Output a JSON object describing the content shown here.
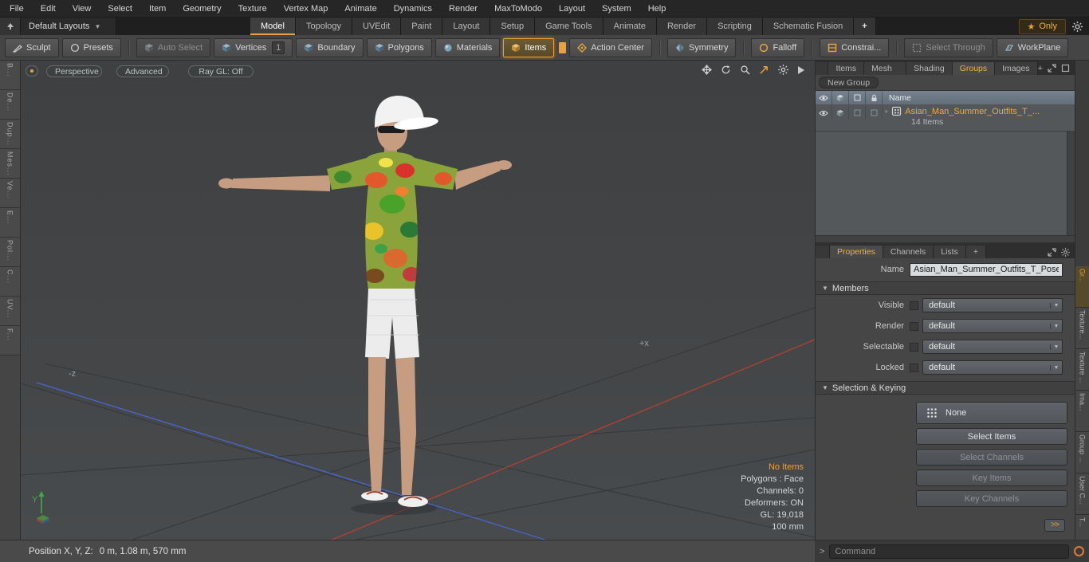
{
  "menu": {
    "items": [
      "File",
      "Edit",
      "View",
      "Select",
      "Item",
      "Geometry",
      "Texture",
      "Vertex Map",
      "Animate",
      "Dynamics",
      "Render",
      "MaxToModo",
      "Layout",
      "System",
      "Help"
    ]
  },
  "layout_bar": {
    "layout_selector": "Default Layouts",
    "tabs": [
      "Model",
      "Topology",
      "UVEdit",
      "Paint",
      "Layout",
      "Setup",
      "Game Tools",
      "Animate",
      "Render",
      "Scripting",
      "Schematic Fusion"
    ],
    "active_tab": "Model",
    "plus_tab": "+",
    "star": "★",
    "only_label": "Only"
  },
  "toolbar": {
    "sculpt": "Sculpt",
    "presets": "Presets",
    "auto_select": "Auto Select",
    "vertices": "Vertices",
    "vertices_count": "1",
    "boundary": "Boundary",
    "polygons": "Polygons",
    "materials": "Materials",
    "items": "Items",
    "action_center": "Action Center",
    "symmetry": "Symmetry",
    "falloff": "Falloff",
    "constraints": "Constrai...",
    "select_through": "Select Through",
    "workplane": "WorkPlane"
  },
  "left_strip": {
    "tabs": [
      "B...",
      "De...",
      "Dup...",
      "Mes...",
      "Ve...",
      "E...",
      "Pol...",
      "C...",
      "UV...",
      "F..."
    ]
  },
  "viewport": {
    "view_mode": "Perspective",
    "shading_mode": "Advanced",
    "raygl": "Ray GL: Off",
    "axis_labels": {
      "neg_z": "-z",
      "pos_x": "+x",
      "y": "Y"
    },
    "info": {
      "selection": "No Items",
      "lines": [
        "Polygons : Face",
        "Channels: 0",
        "Deformers: ON",
        "GL: 19,018",
        "100 mm"
      ]
    }
  },
  "right_panel": {
    "tabs": [
      "Items",
      "Mesh ...",
      "Shading",
      "Groups",
      "Images"
    ],
    "active_tab": "Groups",
    "plus": "+",
    "new_group": "New Group",
    "list": {
      "name_header": "Name",
      "rows": [
        {
          "expander": "+",
          "name": "Asian_Man_Summer_Outfits_T_...",
          "sub": "14 Items"
        }
      ]
    },
    "properties": {
      "tabs": [
        "Properties",
        "Channels",
        "Lists"
      ],
      "active_tab": "Properties",
      "plus": "+",
      "name_label": "Name",
      "name_value": "Asian_Man_Summer_Outfits_T_Pose (",
      "members_header": "Members",
      "fields": [
        {
          "label": "Visible",
          "value": "default"
        },
        {
          "label": "Render",
          "value": "default"
        },
        {
          "label": "Selectable",
          "value": "default"
        },
        {
          "label": "Locked",
          "value": "default"
        }
      ],
      "selection_keying_header": "Selection & Keying",
      "none_button": "None",
      "buttons": [
        {
          "label": "Select Items"
        },
        {
          "label": "Select Channels"
        },
        {
          "label": "Key Items"
        },
        {
          "label": "Key Channels"
        }
      ],
      "expand_button": ">>"
    }
  },
  "right_strip": {
    "tabs": [
      "Gr...",
      "Texture...",
      "Texture ...",
      "Ima...",
      "Group ...",
      "User C...",
      "T..."
    ]
  },
  "status_bar": {
    "position_label": "Position X, Y, Z:",
    "position_value": "0 m, 1.08 m, 570 mm"
  },
  "command_bar": {
    "prompt": ">",
    "placeholder": "Command"
  }
}
